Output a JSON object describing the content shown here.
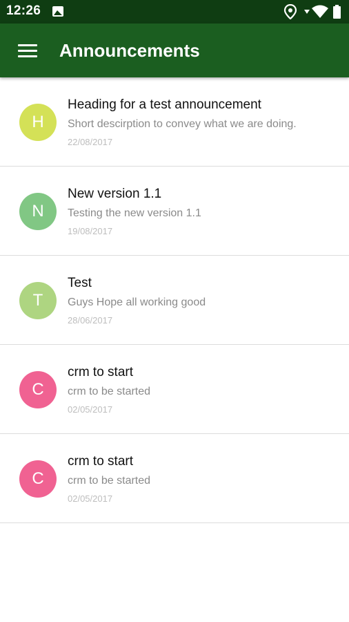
{
  "status_bar": {
    "time": "12:26"
  },
  "app_bar": {
    "title": "Announcements",
    "color": "#1b5e20"
  },
  "announcements": [
    {
      "initial": "H",
      "title": "Heading for a test announcement",
      "description": "Short descirption to convey what we are doing.",
      "date": "22/08/2017",
      "color": "#d4e157"
    },
    {
      "initial": "N",
      "title": "New version 1.1",
      "description": "Testing the new version 1.1",
      "date": "19/08/2017",
      "color": "#81c784"
    },
    {
      "initial": "T",
      "title": "Test",
      "description": "Guys Hope all working good",
      "date": "28/06/2017",
      "color": "#aed581"
    },
    {
      "initial": "C",
      "title": "crm to start",
      "description": "crm to be started",
      "date": "02/05/2017",
      "color": "#f06292"
    },
    {
      "initial": "C",
      "title": "crm to start",
      "description": "crm to be started",
      "date": "02/05/2017",
      "color": "#f06292"
    }
  ]
}
